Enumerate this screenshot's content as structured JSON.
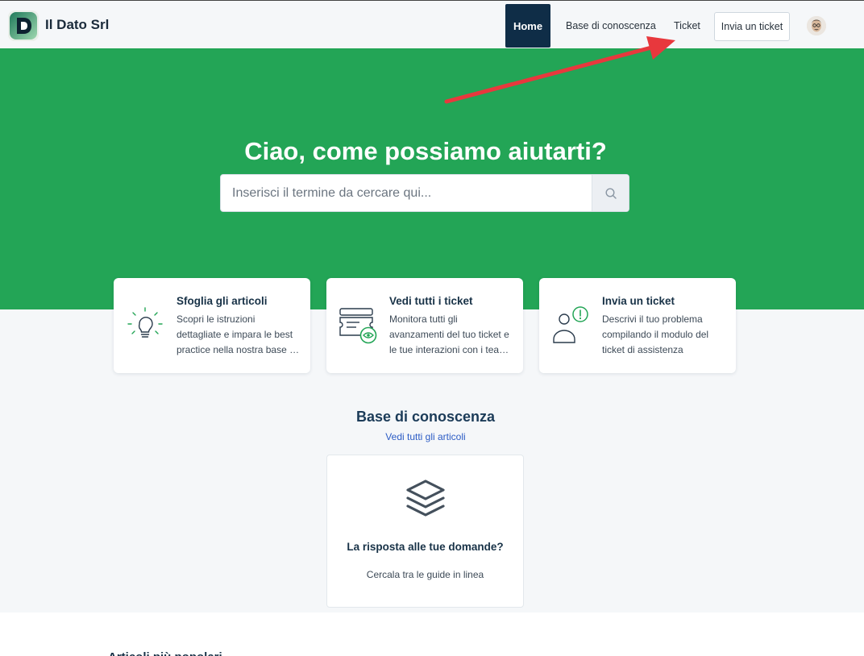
{
  "header": {
    "company_name": "Il Dato Srl",
    "nav": {
      "home": "Home",
      "knowledge_base": "Base di conoscenza",
      "ticket": "Ticket",
      "submit_ticket": "Invia un ticket"
    }
  },
  "hero": {
    "title": "Ciao, come possiamo aiutarti?",
    "search_placeholder": "Inserisci il termine da cercare qui..."
  },
  "cards": [
    {
      "title": "Sfoglia gli articoli",
      "description": "Scopri le istruzioni dettagliate e impara le best practice nella nostra base …",
      "icon": "lightbulb-icon"
    },
    {
      "title": "Vedi tutti i ticket",
      "description": "Monitora tutti gli avanzamenti del tuo ticket e le tue interazioni con i tea…",
      "icon": "tickets-view-icon"
    },
    {
      "title": "Invia un ticket",
      "description": "Descrivi il tuo problema compilando il modulo del ticket di assistenza",
      "icon": "user-alert-icon"
    }
  ],
  "knowledge_base": {
    "title": "Base di conoscenza",
    "view_all": "Vedi tutti gli articoli",
    "card": {
      "title": "La risposta alle tue domande?",
      "description": "Cercala tra le guide in linea",
      "icon": "layers-icon"
    }
  },
  "bottom_heading": "Articoli più popolari",
  "colors": {
    "brand_green": "#23a556",
    "nav_active": "#0f2d47",
    "annotation_arrow": "#e8383d",
    "link": "#2c5cc5"
  }
}
